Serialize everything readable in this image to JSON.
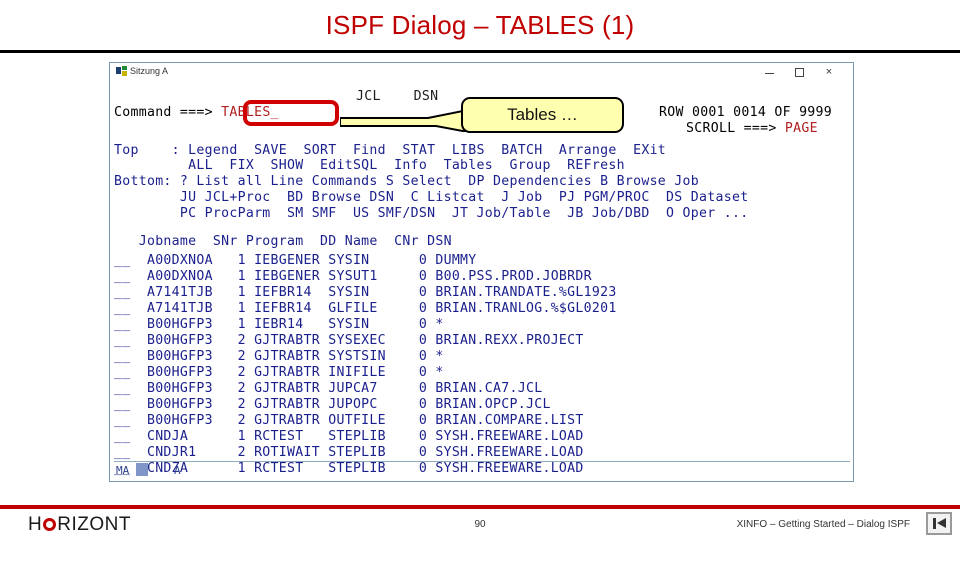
{
  "slide": {
    "title": "ISPF Dialog – TABLES (1)"
  },
  "terminal": {
    "window_title": "Sitzung A",
    "window_controls": {
      "minimize": "–",
      "maximize": "□",
      "close": "×"
    },
    "top_menu_hint": "JCL    DSN",
    "command_label": "Command ===>",
    "command_value": "TABLES_",
    "row_status": "ROW 0001 0014 OF 9999",
    "scroll_label": "SCROLL ===>",
    "scroll_value": "PAGE",
    "menu_lines": [
      "Top    : Legend  SAVE  SORT  Find  STAT  LIBS  BATCH  Arrange  EXit",
      "         ALL  FIX  SHOW  EditSQL  Info  Tables  Group  REFresh",
      "Bottom: ? List all Line Commands S Select  DP Dependencies B Browse Job",
      "        JU JCL+Proc  BD Browse DSN  C Listcat  J Job  PJ PGM/PROC  DS Dataset",
      "        PC ProcParm  SM SMF  US SMF/DSN  JT Job/Table  JB Job/DBD  O Oper ..."
    ],
    "table": {
      "header": "   Jobname  SNr Program  DD Name  CNr DSN",
      "rows": [
        "__  A00DXNOA   1 IEBGENER SYSIN      0 DUMMY",
        "__  A00DXNOA   1 IEBGENER SYSUT1     0 B00.PSS.PROD.JOBRDR",
        "__  A7141TJB   1 IEFBR14  SYSIN      0 BRIAN.TRANDATE.%GL1923",
        "__  A7141TJB   1 IEFBR14  GLFILE     0 BRIAN.TRANLOG.%$GL0201",
        "__  B00HGFP3   1 IEBR14   SYSIN      0 *",
        "__  B00HGFP3   2 GJTRABTR SYSEXEC    0 BRIAN.REXX.PROJECT",
        "__  B00HGFP3   2 GJTRABTR SYSTSIN    0 *",
        "__  B00HGFP3   2 GJTRABTR INIFILE    0 *",
        "__  B00HGFP3   2 GJTRABTR JUPCA7     0 BRIAN.CA7.JCL",
        "__  B00HGFP3   2 GJTRABTR JUPOPC     0 BRIAN.OPCP.JCL",
        "__  B00HGFP3   2 GJTRABTR OUTFILE    0 BRIAN.COMPARE.LIST",
        "__  CNDJA      1 RCTEST   STEPLIB    0 SYSH.FREEWARE.LOAD",
        "__  CNDJR1     2 ROTIWAIT STEPLIB    0 SYSH.FREEWARE.LOAD",
        "__  CNDZA      1 RCTEST   STEPLIB    0 SYSH.FREEWARE.LOAD"
      ]
    },
    "status_bar": {
      "left": "MA",
      "right": "A"
    }
  },
  "callout": {
    "text": "Tables …"
  },
  "footer": {
    "logo_before": "H",
    "logo_after": "RIZONT",
    "page_number": "90",
    "right_text": "XINFO – Getting Started – Dialog ISPF"
  },
  "colors": {
    "title_red": "#c00000",
    "terminal_blue": "#1a1f8c",
    "accent_red": "#b02020",
    "callout_yellow": "#ffffb0"
  }
}
